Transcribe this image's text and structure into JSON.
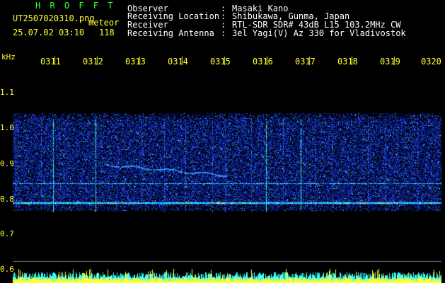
{
  "header": {
    "app_name": "H R O F F T",
    "file_name": "UT2507020310.png",
    "meteor_label": "meteor",
    "datetime": "25.07.02 03:10",
    "meteor_count": "118"
  },
  "station": [
    {
      "label": "Observer",
      "value": "Masaki Kano"
    },
    {
      "label": "Receiving Location",
      "value": "Shibukawa, Gunma, Japan"
    },
    {
      "label": "Receiver",
      "value": "RTL-SDR SDR# 43dB L15 103.2MHz CW"
    },
    {
      "label": "Receiving Antenna",
      "value": "3el Yagi(V) Az 330 for Vladivostok"
    }
  ],
  "axis": {
    "y_unit": "kHz",
    "y_ticks": [
      "1.1",
      "1.0",
      "0.9",
      "0.8",
      "0.7",
      "0.6"
    ],
    "x_ticks": [
      "0311",
      "0312",
      "0313",
      "0314",
      "0315",
      "0316",
      "0317",
      "0318",
      "0319",
      "0320"
    ]
  },
  "colors": {
    "label_yellow": "#ffff33",
    "title_green": "#33ff33",
    "noise_blue": "#1a3cff",
    "echo_cyan": "#33ffff"
  }
}
